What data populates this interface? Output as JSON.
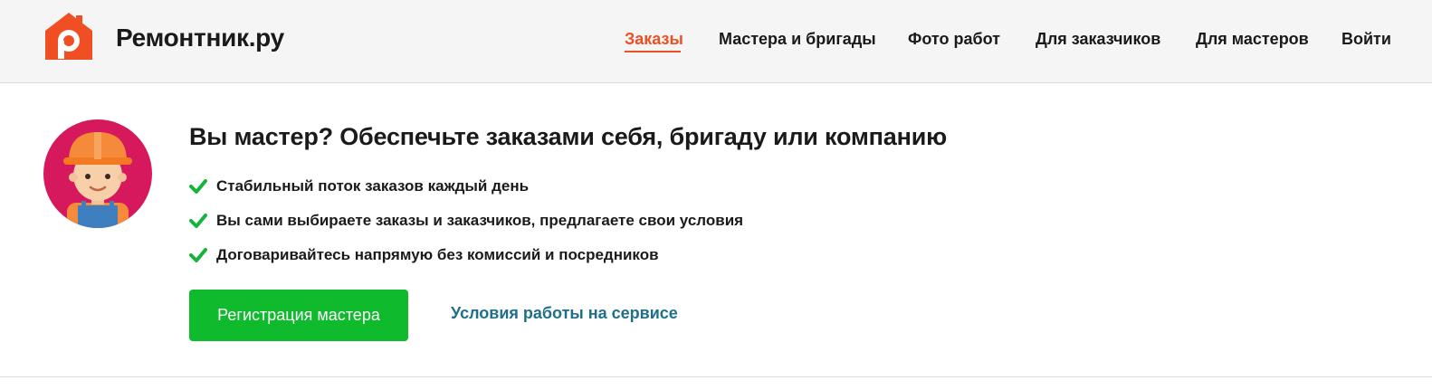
{
  "brand": {
    "name": "Ремонтник.ру",
    "logo_icon": "house-logo-icon",
    "logo_color": "#f04e23"
  },
  "nav": {
    "items": [
      {
        "label": "Заказы",
        "active": true
      },
      {
        "label": "Мастера и бригады",
        "active": false
      },
      {
        "label": "Фото работ",
        "active": false
      },
      {
        "label": "Для заказчиков",
        "active": false
      },
      {
        "label": "Для мастеров",
        "active": false
      },
      {
        "label": "Войти",
        "active": false
      }
    ],
    "active_color": "#f04e23"
  },
  "promo": {
    "avatar_icon": "worker-avatar-icon",
    "avatar_bg_color": "#d6195c",
    "title": "Вы мастер? Обеспечьте заказами себя, бригаду или компанию",
    "benefits": [
      "Стабильный поток заказов каждый день",
      "Вы сами выбираете заказы и заказчиков, предлагаете свои условия",
      "Договаривайтесь напрямую без комиссий и посредников"
    ],
    "check_icon": "check-icon",
    "check_color": "#16b33d",
    "register_button": "Регистрация мастера",
    "register_color": "#0fba2c",
    "terms_link": "Условия работы на сервисе",
    "terms_color": "#1f6f8b"
  }
}
